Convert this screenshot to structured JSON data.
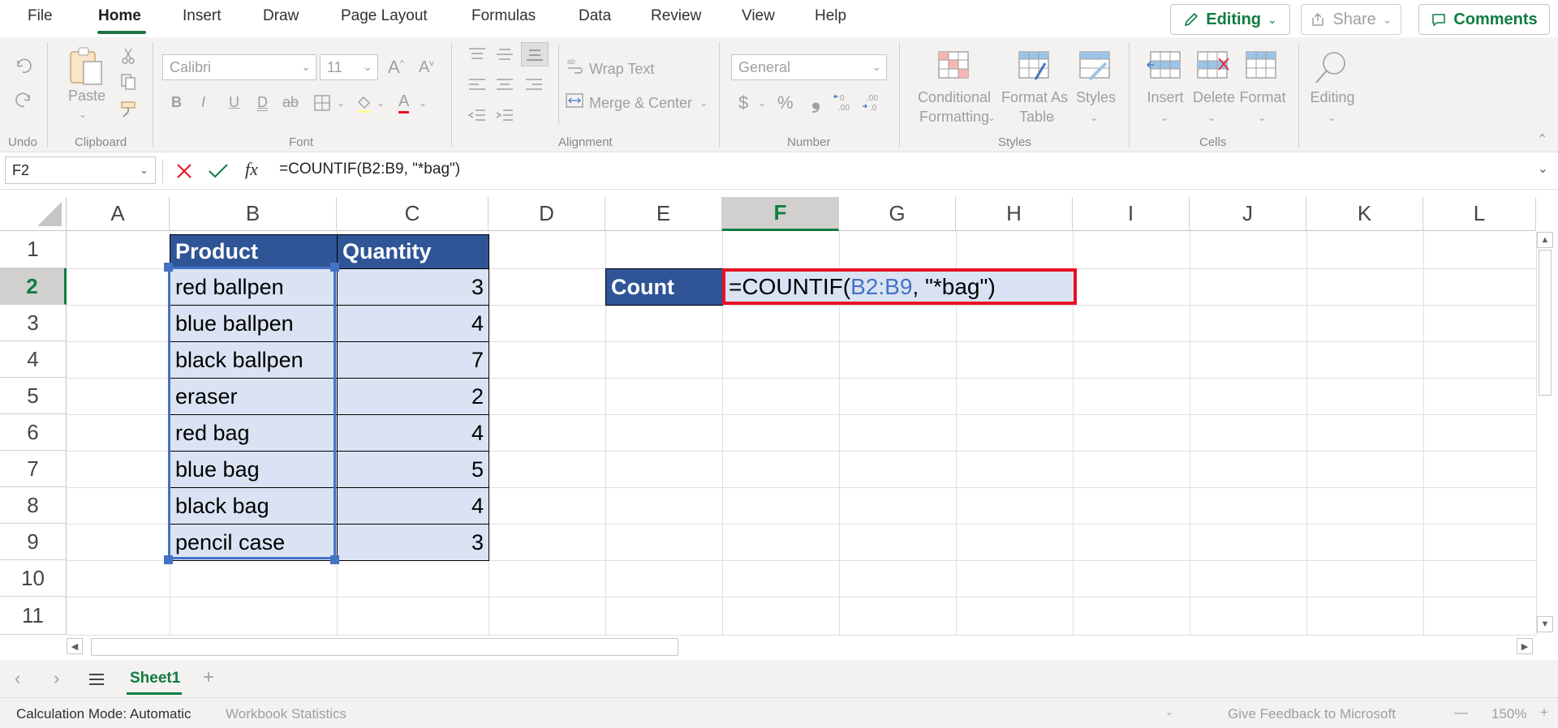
{
  "menu": {
    "tabs": [
      "File",
      "Home",
      "Insert",
      "Draw",
      "Page Layout",
      "Formulas",
      "Data",
      "Review",
      "View",
      "Help"
    ],
    "active_tab": "Home",
    "editing_label": "Editing",
    "share_label": "Share",
    "comments_label": "Comments"
  },
  "ribbon": {
    "undo_group": "Undo",
    "clipboard_group": "Clipboard",
    "paste_label": "Paste",
    "font_group": "Font",
    "font_name": "Calibri",
    "font_size": "11",
    "alignment_group": "Alignment",
    "wrap_text_label": "Wrap Text",
    "merge_center_label": "Merge & Center",
    "number_group": "Number",
    "number_format": "General",
    "styles_group": "Styles",
    "conditional_formatting_label_1": "Conditional",
    "conditional_formatting_label_2": "Formatting",
    "format_as_table_label_1": "Format As",
    "format_as_table_label_2": "Table",
    "styles_label": "Styles",
    "cells_group": "Cells",
    "insert_label": "Insert",
    "delete_label": "Delete",
    "format_label": "Format",
    "editing_label": "Editing",
    "bold": "B",
    "italic": "I",
    "underline": "U",
    "double_underline": "D",
    "strikethrough": "ab",
    "increase_font": "A",
    "decrease_font": "A",
    "font_color": "A",
    "percent": "%",
    "currency": "$",
    "comma": "❟"
  },
  "formula_bar": {
    "name_box": "F2",
    "formula": "=COUNTIF(B2:B9, \"*bag\")",
    "fx": "fx"
  },
  "columns": [
    "A",
    "B",
    "C",
    "D",
    "E",
    "F",
    "G",
    "H",
    "I",
    "J",
    "K",
    "L"
  ],
  "selected_column": "F",
  "rows": [
    "1",
    "2",
    "3",
    "4",
    "5",
    "6",
    "7",
    "8",
    "9",
    "10",
    "11"
  ],
  "selected_row": "2",
  "table": {
    "header_product": "Product",
    "header_quantity": "Quantity",
    "products": [
      "red ballpen",
      "blue ballpen",
      "black ballpen",
      "eraser",
      "red bag",
      "blue bag",
      "black bag",
      "pencil case"
    ],
    "quantities": [
      "3",
      "4",
      "7",
      "2",
      "4",
      "5",
      "4",
      "3"
    ]
  },
  "count_label": "Count",
  "active_cell_formula": {
    "prefix": "=COUNTIF(",
    "ref": "B2:B9",
    "suffix": ", \"*bag\")"
  },
  "sheet": {
    "name": "Sheet1",
    "add": "+"
  },
  "status": {
    "calc_mode": "Calculation Mode: Automatic",
    "workbook_stats": "Workbook Statistics",
    "feedback": "Give Feedback to Microsoft",
    "zoom": "150%",
    "zoom_minus": "—",
    "zoom_plus": "+"
  },
  "colors": {
    "accent_green": "#107c41",
    "header_fill": "#2f5597",
    "data_fill": "#dae3f3",
    "highlight_border": "#e81123",
    "ref_blue": "#4472c4"
  }
}
